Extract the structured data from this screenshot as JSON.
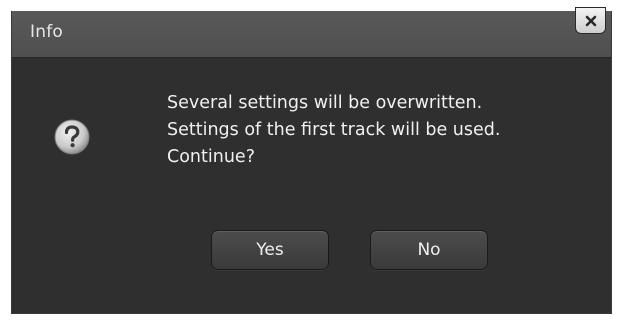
{
  "window": {
    "title": "Info",
    "close_icon": "close-icon"
  },
  "message": {
    "icon": "question-icon",
    "lines": [
      "Several settings will be overwritten.",
      "Settings of the first track will be used.",
      "Continue?"
    ]
  },
  "buttons": {
    "yes_label": "Yes",
    "no_label": "No"
  },
  "colors": {
    "dialog_background": "#2f2f2f",
    "titlebar_background": "#555555",
    "text": "#f0f0f0",
    "button_background": "#434343"
  }
}
